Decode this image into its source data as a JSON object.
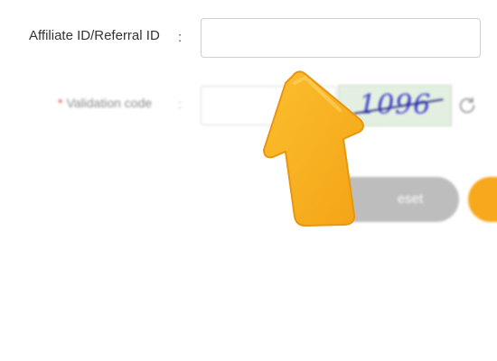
{
  "form": {
    "affiliate": {
      "label": "Affiliate ID/Referral ID",
      "colon": ":",
      "value": "",
      "placeholder": ""
    },
    "validation": {
      "required_mark": "*",
      "label": "Validation code",
      "colon": ":",
      "value": "",
      "placeholder": "",
      "captcha_text": "1096",
      "refresh_icon": "refresh-icon"
    },
    "buttons": {
      "reset_label": "eset",
      "submit_label": ""
    }
  },
  "overlay": {
    "pointer_icon": "arrow-up-icon"
  },
  "colors": {
    "accent": "#f7a81c",
    "arrow": "#f9b21e",
    "required": "#e4493f",
    "captcha_bg": "#e3efe0",
    "captcha_text": "#3b3fc8",
    "reset_bg": "#bdbdbd"
  }
}
